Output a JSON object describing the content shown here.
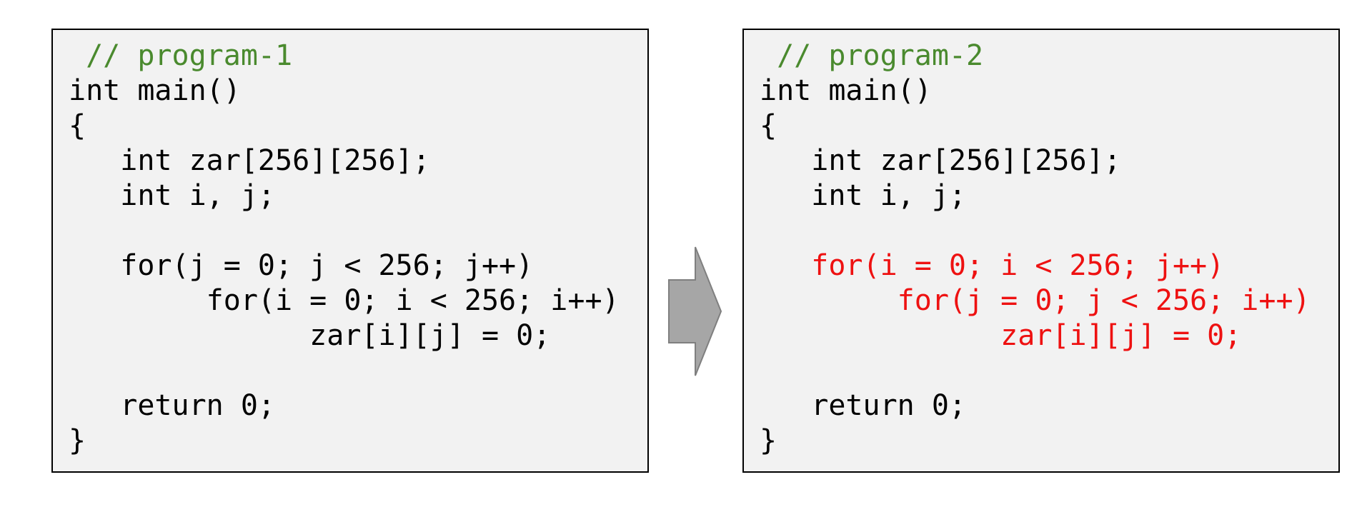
{
  "colors": {
    "panel_background": "#f2f2f2",
    "border": "#000000",
    "code_text": "#000000",
    "comment": "#4a8a2e",
    "highlight": "#ee1111",
    "arrow_fill": "#a6a6a6",
    "arrow_stroke": "#7f7f7f"
  },
  "program_1": {
    "lines": [
      {
        "text": " // program-1",
        "style": "comment"
      },
      {
        "text": "int main()",
        "style": "normal"
      },
      {
        "text": "{",
        "style": "normal"
      },
      {
        "text": "   int zar[256][256];",
        "style": "normal"
      },
      {
        "text": "   int i, j;",
        "style": "normal"
      },
      {
        "text": "",
        "style": "normal"
      },
      {
        "text": "   for(j = 0; j < 256; j++)",
        "style": "normal"
      },
      {
        "text": "        for(i = 0; i < 256; i++)",
        "style": "normal"
      },
      {
        "text": "              zar[i][j] = 0;",
        "style": "normal"
      },
      {
        "text": "",
        "style": "normal"
      },
      {
        "text": "   return 0;",
        "style": "normal"
      },
      {
        "text": "}",
        "style": "normal"
      }
    ]
  },
  "program_2": {
    "lines": [
      {
        "text": " // program-2",
        "style": "comment"
      },
      {
        "text": "int main()",
        "style": "normal"
      },
      {
        "text": "{",
        "style": "normal"
      },
      {
        "text": "   int zar[256][256];",
        "style": "normal"
      },
      {
        "text": "   int i, j;",
        "style": "normal"
      },
      {
        "text": "",
        "style": "normal"
      },
      {
        "text": "   for(i = 0; i < 256; j++)",
        "style": "highlight"
      },
      {
        "text": "        for(j = 0; j < 256; i++)",
        "style": "highlight"
      },
      {
        "text": "              zar[i][j] = 0;",
        "style": "highlight"
      },
      {
        "text": "",
        "style": "normal"
      },
      {
        "text": "   return 0;",
        "style": "normal"
      },
      {
        "text": "}",
        "style": "normal"
      }
    ]
  },
  "arrow": {
    "icon": "right-arrow-icon"
  }
}
